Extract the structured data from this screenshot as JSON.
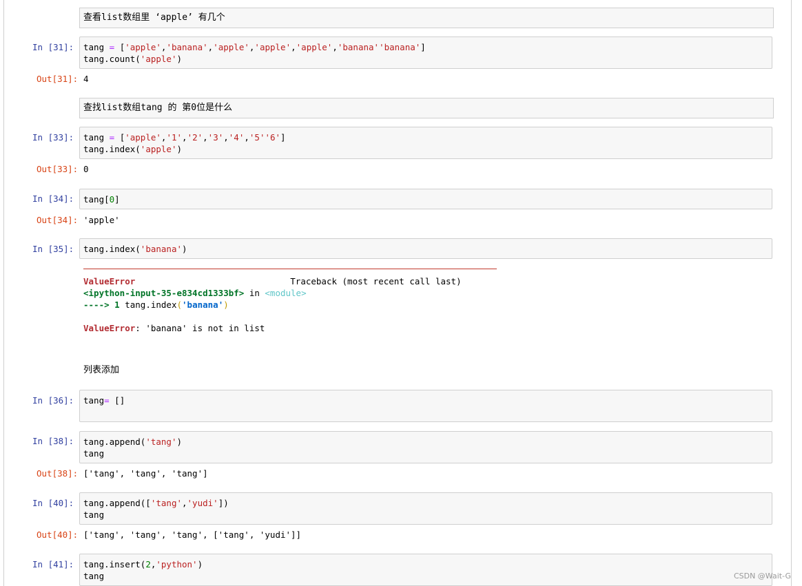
{
  "cells": {
    "md1": "查看list数组里 ‘apple’ 有几个",
    "c31": {
      "prompt": "In  [31]:",
      "line1": [
        "tang ",
        "= ",
        "[",
        "'apple'",
        ",",
        "'banana'",
        ",",
        "'apple'",
        ",",
        "'apple'",
        ",",
        "'apple'",
        ",",
        "'banana''banana'",
        "]"
      ],
      "line2": [
        "tang.count(",
        "'apple'",
        ")"
      ]
    },
    "o31": {
      "prompt": "Out[31]:",
      "value": "4"
    },
    "md2": "查找list数组tang 的 第0位是什么",
    "c33": {
      "prompt": "In  [33]:",
      "line1": [
        "tang ",
        "= ",
        "[",
        "'apple'",
        ",",
        "'1'",
        ",",
        "'2'",
        ",",
        "'3'",
        ",",
        "'4'",
        ",",
        "'5''6'",
        "]"
      ],
      "line2": [
        "tang.index(",
        "'apple'",
        ")"
      ]
    },
    "o33": {
      "prompt": "Out[33]:",
      "value": "0"
    },
    "c34": {
      "prompt": "In  [34]:",
      "code_a": "tang[",
      "code_num": "0",
      "code_b": "]"
    },
    "o34": {
      "prompt": "Out[34]:",
      "value": "'apple'"
    },
    "c35": {
      "prompt": "In  [35]:",
      "code_a": "tang.index(",
      "code_str": "'banana'",
      "code_b": ")"
    },
    "err": {
      "name": "ValueError",
      "traceback": "Traceback (most recent call last)",
      "input": "<ipython-input-35-e834cd1333bf>",
      "in": " in ",
      "module": "<module>",
      "arrow": "----> 1 ",
      "code_a": "tang.index",
      "paren_open": "(",
      "code_str": "'banana'",
      "paren_close": ")",
      "final_name": "ValueError",
      "final_msg": ": 'banana' is not in list"
    },
    "heading": "列表添加",
    "c36": {
      "prompt": "In  [36]:",
      "code_a": "tang",
      "code_op": "=",
      "code_b": " []"
    },
    "c38": {
      "prompt": "In  [38]:",
      "line1_a": "tang.append(",
      "line1_str": "'tang'",
      "line1_b": ")",
      "line2": "tang"
    },
    "o38": {
      "prompt": "Out[38]:",
      "value": "['tang', 'tang', 'tang']"
    },
    "c40": {
      "prompt": "In  [40]:",
      "line1_a": "tang.append([",
      "s1": "'tang'",
      "comma": ",",
      "s2": "'yudi'",
      "line1_b": "])",
      "line2": "tang"
    },
    "o40": {
      "prompt": "Out[40]:",
      "value": "['tang', 'tang', 'tang', ['tang', 'yudi']]"
    },
    "c41": {
      "prompt": "In  [41]:",
      "line1_a": "tang.insert(",
      "num": "2",
      "comma": ",",
      "s1": "'python'",
      "line1_b": ")",
      "line2": "tang"
    }
  },
  "watermark": "CSDN @Wait-G"
}
